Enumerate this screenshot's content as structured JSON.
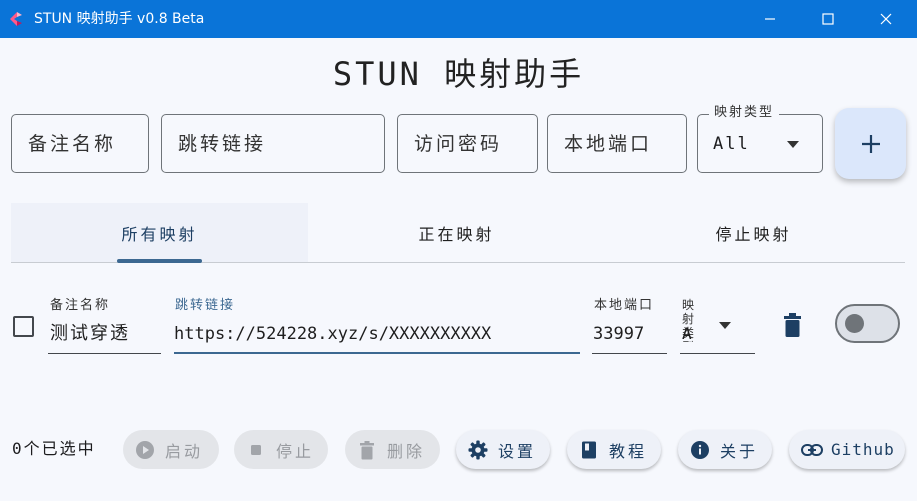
{
  "window": {
    "title": "STUN 映射助手 v0.8 Beta",
    "icon": "app-logo-icon",
    "controls": [
      "minimize-icon",
      "maximize-icon",
      "close-icon"
    ]
  },
  "header": {
    "title": "STUN 映射助手"
  },
  "form": {
    "remark_placeholder": "备注名称",
    "url_placeholder": "跳转链接",
    "password_placeholder": "访问密码",
    "local_port_placeholder": "本地端口",
    "mapping_type_label": "映射类型",
    "mapping_type_value": "All",
    "add_icon": "plus-icon"
  },
  "tabs": [
    {
      "label": "所有映射",
      "selected": true
    },
    {
      "label": "正在映射",
      "selected": false
    },
    {
      "label": "停止映射",
      "selected": false
    }
  ],
  "mappings": [
    {
      "remark_label": "备注名称",
      "remark": "测试穿透",
      "url_label": "跳转链接",
      "url": "https://524228.xyz/s/XXXXXXXXXX",
      "port_label": "本地端口",
      "port": "33997",
      "type_label": "映射类型",
      "type_value": "All",
      "checked": false,
      "enabled": false
    }
  ],
  "footer": {
    "selected_text": "0个已选中",
    "start": "启动",
    "stop": "停止",
    "delete": "删除",
    "settings": "设置",
    "tutorial": "教程",
    "about": "关于",
    "github": "Github"
  },
  "colors": {
    "titlebar": "#0a74d8",
    "accent": "#3c6891",
    "background": "#f6f8fd",
    "add_button": "#dbe7fb"
  }
}
